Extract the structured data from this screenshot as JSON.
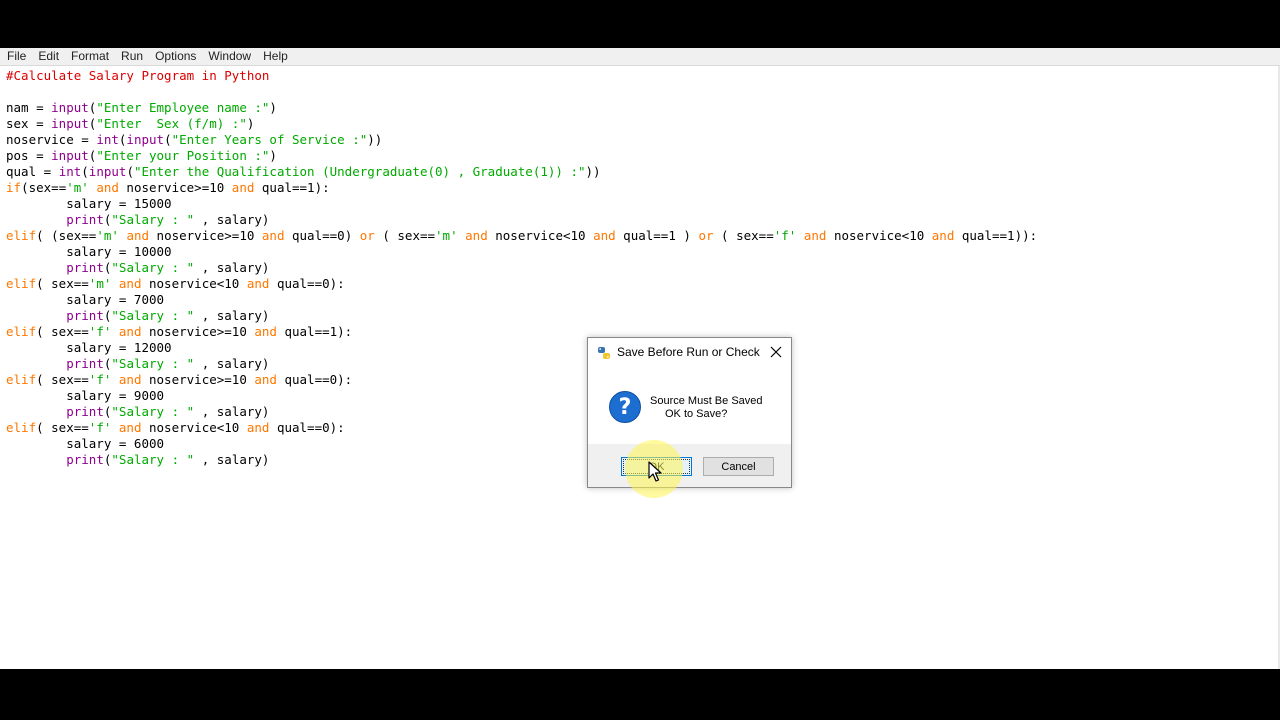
{
  "menu": {
    "items": [
      "File",
      "Edit",
      "Format",
      "Run",
      "Options",
      "Window",
      "Help"
    ]
  },
  "editor": {
    "lines": [
      "#Calculate Salary Program in Python",
      "",
      "nam = input(\"Enter Employee name :\")",
      "sex = input(\"Enter  Sex (f/m) :\")",
      "noservice = int(input(\"Enter Years of Service :\"))",
      "pos = input(\"Enter your Position :\")",
      "qual = int(input(\"Enter the Qualification (Undergraduate(0) , Graduate(1)) :\"))",
      "if(sex=='m' and noservice>=10 and qual==1):",
      "        salary = 15000",
      "        print(\"Salary : \" , salary)",
      "elif( (sex=='m' and noservice>=10 and qual==0) or ( sex=='m' and noservice<10 and qual==1 ) or ( sex=='f' and noservice<10 and qual==1)):",
      "        salary = 10000",
      "        print(\"Salary : \" , salary)",
      "elif( sex=='m' and noservice<10 and qual==0):",
      "        salary = 7000",
      "        print(\"Salary : \" , salary)",
      "elif( sex=='f' and noservice>=10 and qual==1):",
      "        salary = 12000",
      "        print(\"Salary : \" , salary)",
      "elif( sex=='f' and noservice>=10 and qual==0):",
      "        salary = 9000",
      "        print(\"Salary : \" , salary)",
      "elif( sex=='f' and noservice<10 and qual==0):",
      "        salary = 6000",
      "        print(\"Salary : \" , salary)"
    ]
  },
  "dialog": {
    "title": "Save Before Run or Check",
    "message_line1": "Source Must Be Saved",
    "message_line2": "OK to Save?",
    "icon": "question-icon",
    "ok_label": "OK",
    "cancel_label": "Cancel"
  },
  "colors": {
    "keyword": "#ff7700",
    "builtin": "#900090",
    "string": "#00aa00",
    "comment": "#dd0000",
    "accent": "#0078d7"
  }
}
